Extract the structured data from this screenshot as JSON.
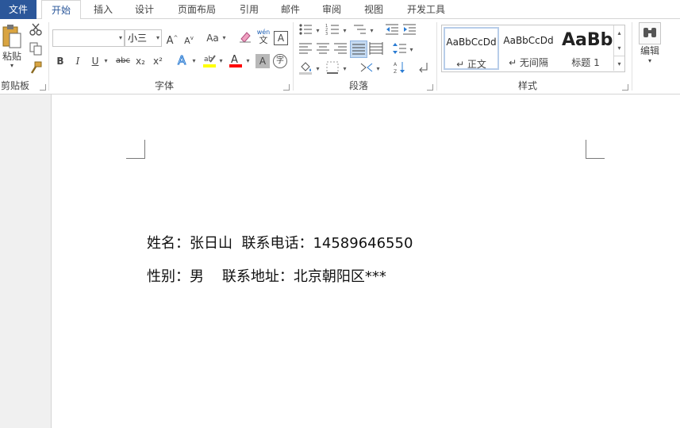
{
  "tabs": [
    {
      "label": "文件"
    },
    {
      "label": "开始"
    },
    {
      "label": "插入"
    },
    {
      "label": "设计"
    },
    {
      "label": "页面布局"
    },
    {
      "label": "引用"
    },
    {
      "label": "邮件"
    },
    {
      "label": "审阅"
    },
    {
      "label": "视图"
    },
    {
      "label": "开发工具"
    }
  ],
  "ribbon": {
    "clipboard": {
      "paste_label": "粘贴",
      "group_label": "剪贴板"
    },
    "font": {
      "font_name": "",
      "font_size": "小三",
      "grow_label": "A",
      "shrink_label": "A",
      "case_label": "Aa",
      "bold": "B",
      "italic": "I",
      "underline": "U",
      "strike": "abc",
      "subscript": "x₂",
      "superscript": "x²",
      "char_border_label": "A",
      "char_shade_label": "A",
      "phonetic_label": "wén",
      "phonetic_sub": "文",
      "enclose_label": "字",
      "group_label": "字体"
    },
    "paragraph": {
      "group_label": "段落"
    },
    "styles": {
      "items": [
        {
          "sample": "AaBbCcDd",
          "name": "↵ 正文"
        },
        {
          "sample": "AaBbCcDd",
          "name": "↵ 无间隔"
        },
        {
          "sample": "AaBb",
          "name": "标题 1"
        }
      ],
      "group_label": "样式"
    },
    "editing": {
      "label": "编辑"
    }
  },
  "document": {
    "lines": [
      "姓名：张日山  联系电话：14589646550",
      "性别：男    联系地址：北京朝阳区***"
    ]
  },
  "colors": {
    "file_tab": "#2b579a",
    "accent": "#2b579a",
    "highlight": "#ffff00",
    "font_color": "#ff0000"
  }
}
